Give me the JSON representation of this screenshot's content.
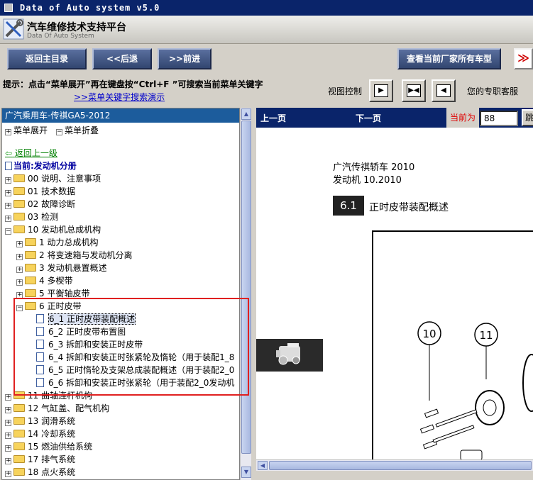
{
  "window": {
    "title": "Data of Auto system v5.0"
  },
  "header": {
    "title": "汽车维修技术支持平台",
    "subtitle": "Data Of Auto System"
  },
  "toolbar": {
    "home": "返回主目录",
    "back": "<<后退",
    "forward": ">>前进",
    "all_models": "查看当前厂家所有车型",
    "more": "≫"
  },
  "hint": {
    "text": "提示：点击“菜单展开”再在键盘按“Ctrl+F ”可搜索当前菜单关键字",
    "link": ">>菜单关键字搜索演示"
  },
  "view": {
    "label": "视图控制",
    "service": "您的专职客服"
  },
  "left": {
    "header": "广汽乘用车-传祺GA5-2012",
    "expand_all": "菜单展开",
    "collapse_all": "菜单折叠",
    "back_up": "返回上一级",
    "current": "当前:发动机分册",
    "tree": [
      {
        "label": "00 说明、注意事项",
        "level": 0,
        "type": "folder",
        "expanded": false
      },
      {
        "label": "01 技术数据",
        "level": 0,
        "type": "folder",
        "expanded": false
      },
      {
        "label": "02 故障诊断",
        "level": 0,
        "type": "folder",
        "expanded": false
      },
      {
        "label": "03 检测",
        "level": 0,
        "type": "folder",
        "expanded": false
      },
      {
        "label": "10 发动机总成机构",
        "level": 0,
        "type": "folder",
        "expanded": true
      },
      {
        "label": "1 动力总成机构",
        "level": 1,
        "type": "folder",
        "expanded": false
      },
      {
        "label": "2 将变速箱与发动机分离",
        "level": 1,
        "type": "folder",
        "expanded": false
      },
      {
        "label": "3 发动机悬置概述",
        "level": 1,
        "type": "folder",
        "expanded": false
      },
      {
        "label": "4 多楔带",
        "level": 1,
        "type": "folder",
        "expanded": false
      },
      {
        "label": "5 平衡轴皮带",
        "level": 1,
        "type": "folder",
        "expanded": false
      },
      {
        "label": "6 正时皮带",
        "level": 1,
        "type": "folder",
        "expanded": true
      },
      {
        "label": "6_1 正时皮带装配概述",
        "level": 2,
        "type": "doc",
        "selected": true
      },
      {
        "label": "6_2 正时皮带布置图",
        "level": 2,
        "type": "doc"
      },
      {
        "label": "6_3 拆卸和安装正时皮带",
        "level": 2,
        "type": "doc"
      },
      {
        "label": "6_4 拆卸和安装正时张紧轮及惰轮（用于装配1_8",
        "level": 2,
        "type": "doc"
      },
      {
        "label": "6_5 正时惰轮及支架总成装配概述（用于装配2_0",
        "level": 2,
        "type": "doc"
      },
      {
        "label": "6_6 拆卸和安装正时张紧轮（用于装配2_0发动机",
        "level": 2,
        "type": "doc"
      },
      {
        "label": "11 曲轴连杆机构",
        "level": 0,
        "type": "folder",
        "expanded": false
      },
      {
        "label": "12 气缸盖、配气机构",
        "level": 0,
        "type": "folder",
        "expanded": false
      },
      {
        "label": "13 润滑系统",
        "level": 0,
        "type": "folder",
        "expanded": false
      },
      {
        "label": "14 冷却系统",
        "level": 0,
        "type": "folder",
        "expanded": false
      },
      {
        "label": "15 燃油供给系统",
        "level": 0,
        "type": "folder",
        "expanded": false
      },
      {
        "label": "17 排气系统",
        "level": 0,
        "type": "folder",
        "expanded": false
      },
      {
        "label": "18 点火系统",
        "level": 0,
        "type": "folder",
        "expanded": false
      }
    ]
  },
  "viewer": {
    "prev": "上一页",
    "next": "下一页",
    "current_label": "当前为",
    "page": "88",
    "go": "跳",
    "doc_line1": "广汽传祺轿车 2010",
    "doc_line2": "发动机 10.2010",
    "section_num": "6.1",
    "section_title": "正时皮带装配概述",
    "callout_10": "10",
    "callout_11": "11"
  }
}
